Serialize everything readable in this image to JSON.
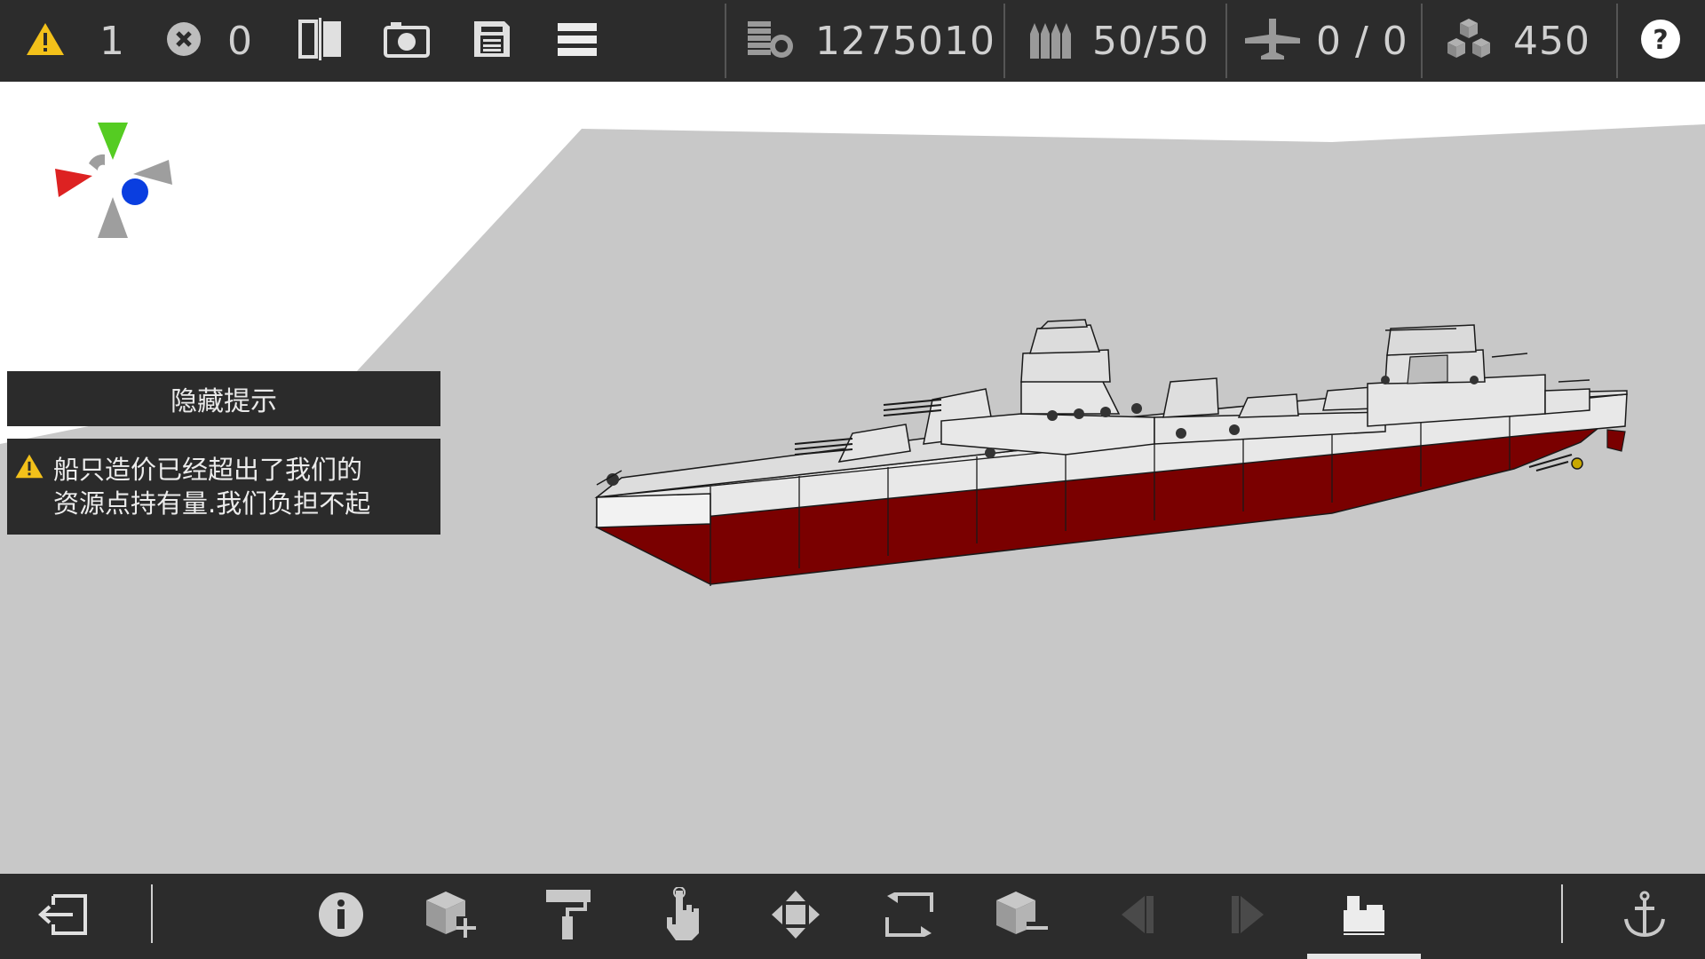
{
  "topbar": {
    "warnings": {
      "icon": "warning-icon",
      "count": "1"
    },
    "errors": {
      "icon": "error-circle-icon",
      "count": "0"
    },
    "tools": [
      "mirror-icon",
      "camera-icon",
      "save-icon",
      "menu-icon"
    ],
    "stats": [
      {
        "icon": "money-coins-icon",
        "value": "1275010"
      },
      {
        "icon": "ammo-icon",
        "value": "50/50"
      },
      {
        "icon": "aircraft-icon",
        "value": "0 / 0"
      },
      {
        "icon": "resource-cubes-icon",
        "value": "450"
      }
    ],
    "help_icon": "help-icon"
  },
  "hint": {
    "hide_button_label": "隐藏提示",
    "message": "船只造价已经超出了我们的\n资源点持有量.我们负担不起"
  },
  "bottombar": {
    "left": [
      "exit-icon"
    ],
    "tools": [
      "info-icon",
      "add-block-icon",
      "paint-roller-icon",
      "hand-select-icon",
      "move-icon",
      "rotate-icon",
      "remove-block-icon",
      "previous-icon",
      "next-icon",
      "parts-icon"
    ],
    "right": [
      "anchor-icon"
    ],
    "active_tool": "parts-icon"
  },
  "colors": {
    "bar": "#2c2c2c",
    "ground": "#c8c8c8",
    "hull_red": "#7a0000",
    "ship_grey": "#e8e8e8",
    "warning_yellow": "#f3c11a",
    "gizmo_green": "#55cc22",
    "gizmo_red": "#dd2222",
    "gizmo_blue": "#0a3ee0"
  }
}
